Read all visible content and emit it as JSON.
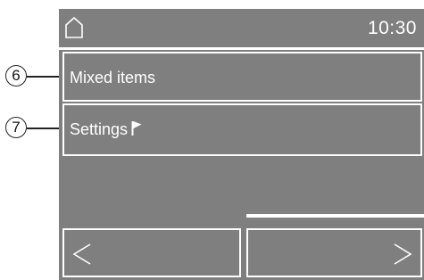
{
  "callouts": {
    "six": "6",
    "seven": "7"
  },
  "status_bar": {
    "home_icon": "home-icon",
    "time": "10:30"
  },
  "menu": {
    "items": [
      {
        "label": "Mixed items"
      },
      {
        "label": "Settings",
        "icon": "flag-icon"
      }
    ]
  },
  "navigation": {
    "back_icon": "chevron-left-icon",
    "forward_icon": "chevron-right-icon"
  },
  "colors": {
    "display_background": "#807f80",
    "foreground": "#ffffff"
  }
}
